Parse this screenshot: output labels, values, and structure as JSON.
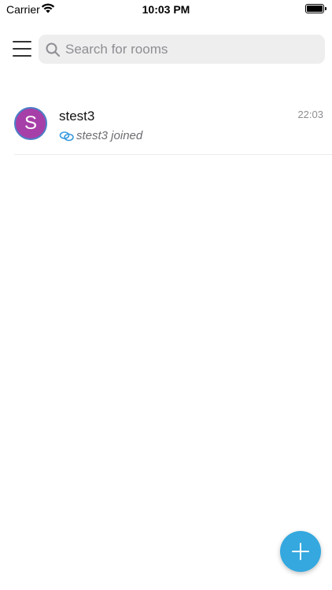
{
  "status_bar": {
    "carrier": "Carrier",
    "time": "10:03 PM"
  },
  "header": {
    "search_placeholder": "Search for rooms"
  },
  "rooms": [
    {
      "avatar_letter": "S",
      "name": "stest3",
      "time": "22:03",
      "last_event": "stest3 joined",
      "avatar_color": "#a73fa8"
    }
  ],
  "colors": {
    "accent": "#34a8df",
    "search_bg": "#eeeeef"
  }
}
